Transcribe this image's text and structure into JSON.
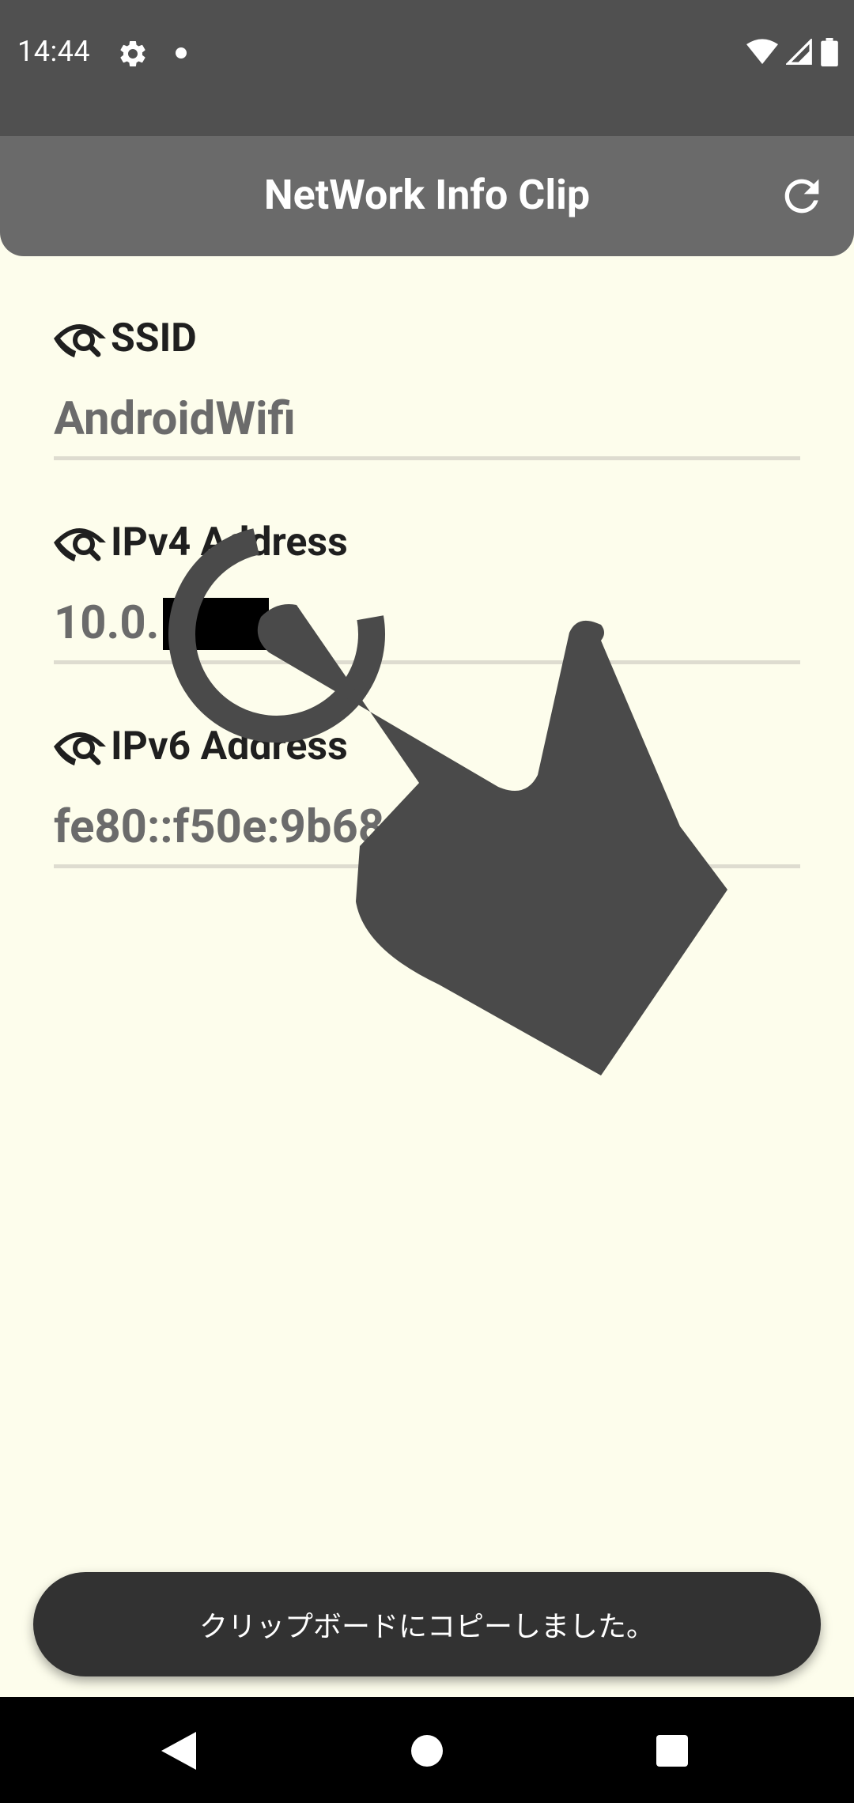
{
  "status_bar": {
    "time": "14:44",
    "icons": [
      "settings-icon",
      "notification-dot-icon",
      "wifi-icon",
      "cellular-signal-icon",
      "battery-icon"
    ]
  },
  "app_bar": {
    "title": "NetWork Info Clip",
    "refresh_icon": "refresh-icon"
  },
  "items": [
    {
      "label": "SSID",
      "value": "AndroidWifi",
      "icon": "eye-search-icon"
    },
    {
      "label": "IPv4 Address",
      "value": "10.0.",
      "icon": "eye-search-icon",
      "redacted": true
    },
    {
      "label": "IPv6 Address",
      "value": "fe80::f50e:9b68",
      "icon": "eye-search-icon"
    }
  ],
  "toast": {
    "message": "クリップボードにコピーしました。"
  },
  "nav_bar": {
    "buttons": [
      "back-icon",
      "home-icon",
      "recents-icon"
    ]
  },
  "colors": {
    "status_bar": "#505050",
    "app_bar": "#6a6a6a",
    "background": "#fdfdec",
    "toast": "#323232",
    "value_text": "#6b6b6b"
  }
}
